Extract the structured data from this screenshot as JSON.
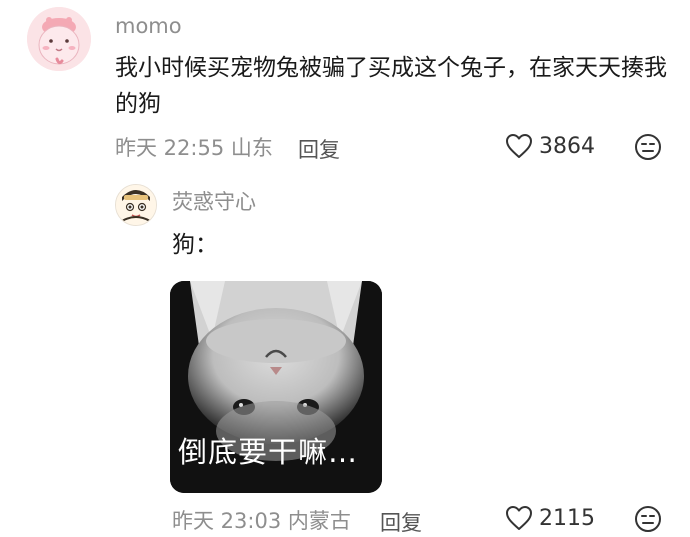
{
  "main_comment": {
    "username": "momo",
    "text": "我小时候买宠物兔被骗了买成这个兔子，在家天天揍我的狗",
    "time_location": "昨天 22:55 山东",
    "reply_label": "回复",
    "like_count": "3864"
  },
  "reply_comment": {
    "username": "荧惑守心",
    "text": "狗：",
    "sticker_caption": "倒底要干嘛…",
    "time_location": "昨天 23:03 内蒙古",
    "reply_label": "回复",
    "like_count": "2115"
  }
}
